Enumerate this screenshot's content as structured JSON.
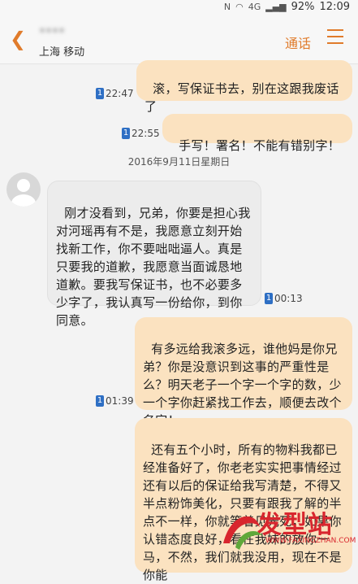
{
  "status": {
    "battery": "92%",
    "time": "12:09",
    "signal": "4G"
  },
  "header": {
    "contact_name": "****",
    "subtitle": "上海 移动",
    "call_label": "通话"
  },
  "date_separator": "2016年9月11日星期日",
  "messages": [
    {
      "text": "滚，写保证书去，别在这跟我废话了",
      "time": "22:47",
      "sim": "1"
    },
    {
      "text": "手写！署名！不能有错别字！",
      "time": "22:55",
      "sim": "1"
    },
    {
      "text": "刚才没看到，兄弟，你要是担心我对河瑶再有不是，我愿意立刻开始找新工作，你不要咄咄逼人。真是只要我的道歉，我愿意当面诚恳地道歉。要我写保证书，也不必要多少字了，我认真写一份给你，到你同意。",
      "time": "00:13",
      "sim": "1"
    },
    {
      "text": "有多远给我滚多远，谁他妈是你兄弟？你是没意识到这事的严重性是么？明天老子一个字一个字的数，少一个字你赶紧找工作去，顺便去改个名字！",
      "time": "01:39",
      "sim": "1"
    },
    {
      "text": "还有五个小时，所有的物料我都已经准备好了，你老老实实把事情经过还有以后的保证给我写清楚，不得又半点粉饰美化，只要有跟我了解的半点不一样，你就等着见光死，如果你认错态度良好，看在我妹的放你一马，不然，我们就我没用，现在不是你能",
      "time": "",
      "sim": ""
    }
  ],
  "watermark": {
    "text": "发型站",
    "url": "WWW.FAXINGZHAN.COM"
  }
}
